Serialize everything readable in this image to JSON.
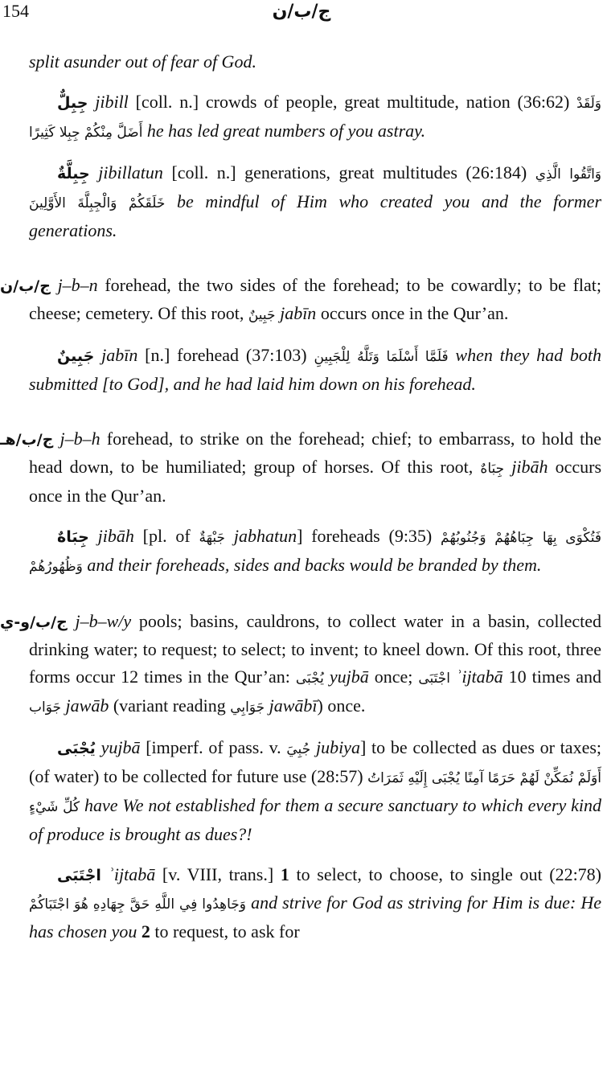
{
  "header": {
    "page_number": "154",
    "running_head": "ج/ب/ن"
  },
  "entries": [
    {
      "text1": "split asunder out of fear of God."
    },
    {
      "headword": "جِبِلٌّ",
      "translit": "jibill",
      "text1": " [coll. n.] crowds of people, great multitude, nation (36:62) ",
      "arabic": "وَلَقَدْ أَضَلَّ مِنْكُمْ جِبِلا كَثِيرًا",
      "text2": " ",
      "gloss": "he has led great numbers of you astray."
    },
    {
      "headword": "جِبِلَّةٌ",
      "translit": "jibillatun",
      "text1": " [coll. n.] generations, great multitudes (26:184) ",
      "arabic": "وَاتَّقُوا الَّذِي خَلَقَكُمْ وَالْجِبِلَّةَ الأَوَّلِينَ",
      "text2": " ",
      "gloss": "be mindful of Him who created you and the former generations."
    },
    {
      "root": "ج/ب/ن",
      "translit": "j–b–n",
      "text1": " forehead, the two sides of the forehead; to be cowardly; to be flat; cheese; cemetery. Of this root, ",
      "arabic": "جَبِينٌ",
      "text2": " ",
      "translit2": "jabīn",
      "text3": " occurs once in the Qur’an."
    },
    {
      "headword": "جَبِينٌ",
      "translit": "jabīn",
      "text1": " [n.] forehead (37:103) ",
      "arabic": "فَلَمَّا أَسْلَمَا وَتَلَّهُ لِلْجَبِينِ",
      "text2": " ",
      "gloss": "when they had both submitted [to God], and he had laid him down on his forehead."
    },
    {
      "root": "ج/ب/هـ",
      "translit": "j–b–h",
      "text1": " forehead, to strike on the forehead; chief; to embarrass, to hold the head down, to be humiliated; group of horses. Of this root, ",
      "arabic": "جِبَاهٌ",
      "text2": "",
      "translit2": "jibāh",
      "text3": " occurs once in the Qur’an."
    },
    {
      "headword": "جِبَاهٌ",
      "translit": "jibāh",
      "text1": " [pl. of ",
      "arabic_pl": "جَبْهَةٌ",
      "text_pl": " ",
      "translit_pl": "jabhatun",
      "text2": "] foreheads (9:35) ",
      "arabic": "فَتُكْوَى بِهَا جِبَاهُهُمْ وَجُنُوبُهُمْ وَظُهُورُهُمْ",
      "text3": " ",
      "gloss": "and their foreheads, sides and backs would be branded by them."
    },
    {
      "root": "ج/ب/و-ي",
      "translit": "j–b–w/y",
      "text1": " pools; basins, cauldrons, to collect water in a basin, collected drinking water; to request; to select; to invent; to kneel down. Of this root, three forms occur 12 times in the Qur’an: ",
      "arabic_a": "يُجْبَى",
      "text_a": " ",
      "translit_a": "yujbā",
      "text_b": " once; ",
      "arabic_b": "اجْتَبَى",
      "text_c": " ",
      "translit_b": "ʾijtabā",
      "text_d": " 10 times and ",
      "arabic_c": "جَوَاب",
      "text_e": " ",
      "translit_c": "jawāb",
      "text_f": " (variant reading ",
      "arabic_d": "جَوَابِي",
      "text_g": " ",
      "translit_d": "jawābī",
      "text_h": ") once."
    },
    {
      "headword": "يُجْبَى",
      "translit": "yujbā",
      "text1": " [imperf. of pass. v. ",
      "arabic_v": "جُبِيَ",
      "text_v": " ",
      "translit_v": "jubiya",
      "text2": "] to be collected as dues or taxes; (of water) to be collected for future use (28:57) ",
      "arabic": "أَوَلَمْ نُمَكِّنْ لَهُمْ حَرَمًا آمِنًا يُجْبَى إِلَيْهِ ثَمَرَاتُ كُلِّ شَيْءٍ",
      "text3": " ",
      "gloss": "have We not established for them a secure sanctuary to which every kind of produce is brought as dues?!"
    },
    {
      "headword": "اجْتَبَى",
      "translit": "ʾijtabā",
      "text1": " [v. VIII, trans.] ",
      "num1": "1",
      "text2": " to select, to choose, to single out (22:78) ",
      "arabic": "وَجَاهِدُوا فِي اللَّهِ حَقَّ جِهَادِهِ هُوَ اجْتَبَاكُمْ",
      "text3": " ",
      "gloss": "and strive for God as striving for Him is due: He has chosen you",
      "text4": " ",
      "num2": "2",
      "text5": " to request, to ask for"
    }
  ]
}
